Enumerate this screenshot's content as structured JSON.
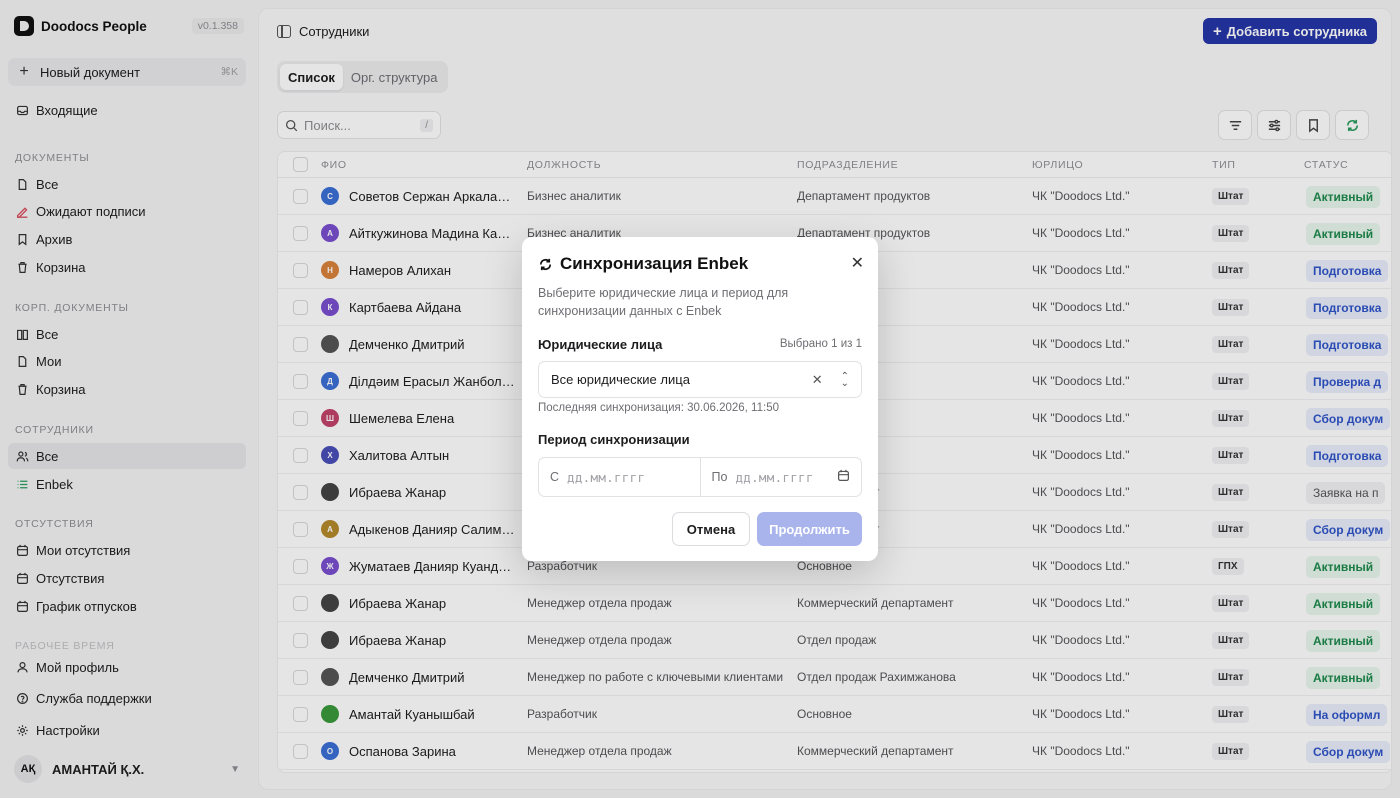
{
  "app": {
    "name": "Doodocs People",
    "version": "v0.1.358"
  },
  "sidebar": {
    "new_doc": {
      "label": "Новый документ",
      "shortcut": "⌘K"
    },
    "inbox": "Входящие",
    "sections": {
      "documents": "ДОКУМЕНТЫ",
      "corp": "КОРП. ДОКУМЕНТЫ",
      "employees": "СОТРУДНИКИ",
      "absences": "ОТСУТСТВИЯ",
      "worktime": "РАБОЧЕЕ ВРЕМЯ"
    },
    "documents": [
      "Все",
      "Ожидают подписи",
      "Архив",
      "Корзина"
    ],
    "corp": [
      "Все",
      "Мои",
      "Корзина"
    ],
    "employees": [
      "Все",
      "Enbek"
    ],
    "absences": [
      "Мои отсутствия",
      "Отсутствия",
      "График отпусков"
    ],
    "bottom": [
      "Мой профиль",
      "Служба поддержки",
      "Настройки"
    ],
    "user": {
      "initials": "АҚ",
      "name": "АМАНТАЙ Қ.Х."
    }
  },
  "header": {
    "breadcrumb": "Сотрудники",
    "add_button": "Добавить сотрудника"
  },
  "tabs": [
    "Список",
    "Орг. структура"
  ],
  "search": {
    "placeholder": "Поиск...",
    "shortcut": "/"
  },
  "table": {
    "columns": [
      "ФИО",
      "ДОЛЖНОСТЬ",
      "ПОДРАЗДЕЛЕНИЕ",
      "ЮРЛИЦО",
      "ТИП",
      "СТАТУС"
    ],
    "rows": [
      {
        "initial": "С",
        "name": "Советов Сержан Аркалаевич",
        "position": "Бизнес аналитик",
        "dept": "Департамент продуктов",
        "org": "ЧК \"Doodocs Ltd.\"",
        "type": "Штат",
        "status": "Активный",
        "status_kind": "active"
      },
      {
        "initial": "А",
        "name": "Айткужинова Мадина Кайратовна",
        "position": "Бизнес аналитик",
        "dept": "Департамент продуктов",
        "org": "ЧК \"Doodocs Ltd.\"",
        "type": "Штат",
        "status": "Активный",
        "status_kind": "active"
      },
      {
        "initial": "Н",
        "name": "Намеров Алихан",
        "position": "",
        "dept": "",
        "org": "ЧК \"Doodocs Ltd.\"",
        "type": "Штат",
        "status": "Подготовка",
        "status_kind": "blue"
      },
      {
        "initial": "К",
        "name": "Картбаева Айдана",
        "position": "",
        "dept": "",
        "org": "ЧК \"Doodocs Ltd.\"",
        "type": "Штат",
        "status": "Подготовка",
        "status_kind": "blue"
      },
      {
        "initial": "",
        "name": "Демченко Дмитрий",
        "position": "",
        "dept": "",
        "org": "ЧК \"Doodocs Ltd.\"",
        "type": "Штат",
        "status": "Подготовка",
        "status_kind": "blue"
      },
      {
        "initial": "Д",
        "name": "Ділдәим Ерасыл Жанболатұлы",
        "position": "",
        "dept": "",
        "org": "ЧК \"Doodocs Ltd.\"",
        "type": "Штат",
        "status": "Проверка д",
        "status_kind": "blue"
      },
      {
        "initial": "Ш",
        "name": "Шемелева Елена",
        "position": "",
        "dept": "",
        "org": "ЧК \"Doodocs Ltd.\"",
        "type": "Штат",
        "status": "Сбор докум",
        "status_kind": "blue"
      },
      {
        "initial": "Х",
        "name": "Халитова Алтын",
        "position": "",
        "dept": "",
        "org": "ЧК \"Doodocs Ltd.\"",
        "type": "Штат",
        "status": "Подготовка",
        "status_kind": "blue"
      },
      {
        "initial": "",
        "name": "Ибраева Жанар",
        "position": "",
        "dept": "й департамент",
        "org": "ЧК \"Doodocs Ltd.\"",
        "type": "Штат",
        "status": "Заявка на п",
        "status_kind": "gray"
      },
      {
        "initial": "А",
        "name": "Адыкенов Данияр Салимжанович",
        "position": "",
        "dept": "й департамент",
        "org": "ЧК \"Doodocs Ltd.\"",
        "type": "Штат",
        "status": "Сбор докум",
        "status_kind": "blue"
      },
      {
        "initial": "Ж",
        "name": "Жуматаев Данияр Куандыкович",
        "position": "Разработчик",
        "dept": "Основное",
        "org": "ЧК \"Doodocs Ltd.\"",
        "type": "ГПХ",
        "status": "Активный",
        "status_kind": "active"
      },
      {
        "initial": "",
        "name": "Ибраева Жанар",
        "position": "Менеджер отдела продаж",
        "dept": "Коммерческий департамент",
        "org": "ЧК \"Doodocs Ltd.\"",
        "type": "Штат",
        "status": "Активный",
        "status_kind": "active"
      },
      {
        "initial": "",
        "name": "Ибраева Жанар",
        "position": "Менеджер отдела продаж",
        "dept": "Отдел продаж",
        "org": "ЧК \"Doodocs Ltd.\"",
        "type": "Штат",
        "status": "Активный",
        "status_kind": "active"
      },
      {
        "initial": "",
        "name": "Демченко Дмитрий",
        "position": "Менеджер по работе с ключевыми клиентами",
        "dept": "Отдел продаж Рахимжанова",
        "org": "ЧК \"Doodocs Ltd.\"",
        "type": "Штат",
        "status": "Активный",
        "status_kind": "active"
      },
      {
        "initial": "",
        "name": "Амантай Куанышбай",
        "position": "Разработчик",
        "dept": "Основное",
        "org": "ЧК \"Doodocs Ltd.\"",
        "type": "Штат",
        "status": "На оформл",
        "status_kind": "blue"
      },
      {
        "initial": "О",
        "name": "Оспанова Зарина",
        "position": "Менеджер отдела продаж",
        "dept": "Коммерческий департамент",
        "org": "ЧК \"Doodocs Ltd.\"",
        "type": "Штат",
        "status": "Сбор докум",
        "status_kind": "blue"
      }
    ]
  },
  "modal": {
    "title": "Синхронизация Enbek",
    "description": "Выберите юридические лица и период для синхронизации данных с Enbek",
    "entities_label": "Юридические лица",
    "selected_count": "Выбрано 1 из 1",
    "select_value": "Все юридические лица",
    "last_sync": "Последняя синхронизация: 30.06.2026, 11:50",
    "period_label": "Период синхронизации",
    "from_prefix": "С",
    "to_prefix": "По",
    "date_placeholder": "дд.мм.гггг",
    "cancel": "Отмена",
    "continue": "Продолжить"
  },
  "colors": {
    "primary": "#2536a8",
    "primary_disabled": "#a9b4ec",
    "active_text": "#1f8a4c",
    "active_bg": "#e7f6ec",
    "blue_text": "#2f54c8",
    "blue_bg": "#e8eefb"
  }
}
